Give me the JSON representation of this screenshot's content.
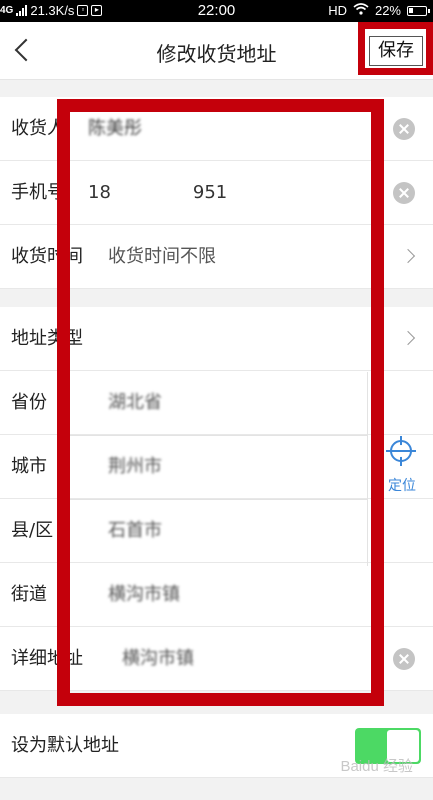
{
  "status_bar": {
    "network": "4G",
    "speed": "21.3K/s",
    "time": "22:00",
    "hd": "HD",
    "battery": "22%"
  },
  "nav": {
    "title": "修改收货地址",
    "save_label": "保存"
  },
  "fields": {
    "receiver": {
      "label": "收货人",
      "value": "陈美彤"
    },
    "phone": {
      "label": "手机号",
      "value_start": "18",
      "value_end": "951"
    },
    "delivery_time": {
      "label": "收货时间",
      "value": "收货时间不限"
    },
    "address_type": {
      "label": "地址类型"
    },
    "province": {
      "label": "省份",
      "value": "湖北省"
    },
    "city": {
      "label": "城市",
      "value": "荆州市"
    },
    "district": {
      "label": "县/区",
      "value": "石首市"
    },
    "street": {
      "label": "街道",
      "value": "横沟市镇"
    },
    "detail": {
      "label": "详细地址",
      "value": "横沟市镇"
    }
  },
  "locate_label": "定位",
  "default_address": {
    "label": "设为默认地址",
    "enabled": true
  },
  "colors": {
    "highlight": "#c4000b",
    "accent": "#3a86d8",
    "toggle_on": "#4cd964"
  },
  "watermark": "Baidu 经验"
}
